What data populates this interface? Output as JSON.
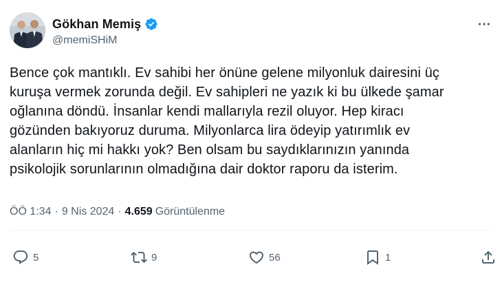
{
  "author": {
    "display_name": "Gökhan Memiş",
    "handle": "@memiSHiM",
    "verified": true
  },
  "tweet": {
    "text": "Bence çok mantıklı. Ev sahibi her önüne gelene milyonluk dairesini üç\nkuruşa vermek zorunda değil. Ev sahipleri ne yazık ki bu ülkede şamar\noğlanına döndü. İnsanlar kendi mallarıyla rezil oluyor. Hep kiracı\ngözünden bakıyoruz duruma. Milyonlarca lira ödeyip yatırımlık ev\nalanların hiç mi hakkı yok? Ben olsam bu saydıklarınızın yanında\npsikolojik sorunlarının olmadığına dair doktor raporu da isterim."
  },
  "meta": {
    "time": "ÖÖ 1:34",
    "separator": "·",
    "date": "9 Nis 2024",
    "views_count": "4.659",
    "views_label": "Görüntülenme"
  },
  "actions": {
    "replies": "5",
    "reposts": "9",
    "likes": "56",
    "bookmarks": "1"
  },
  "icons": {
    "verified": "verified-badge-icon",
    "more": "more-options-icon",
    "reply": "reply-icon",
    "repost": "repost-icon",
    "like": "like-icon",
    "bookmark": "bookmark-icon",
    "share": "share-icon"
  },
  "colors": {
    "text": "#0f1419",
    "secondary": "#536471",
    "verified": "#1d9bf0"
  }
}
